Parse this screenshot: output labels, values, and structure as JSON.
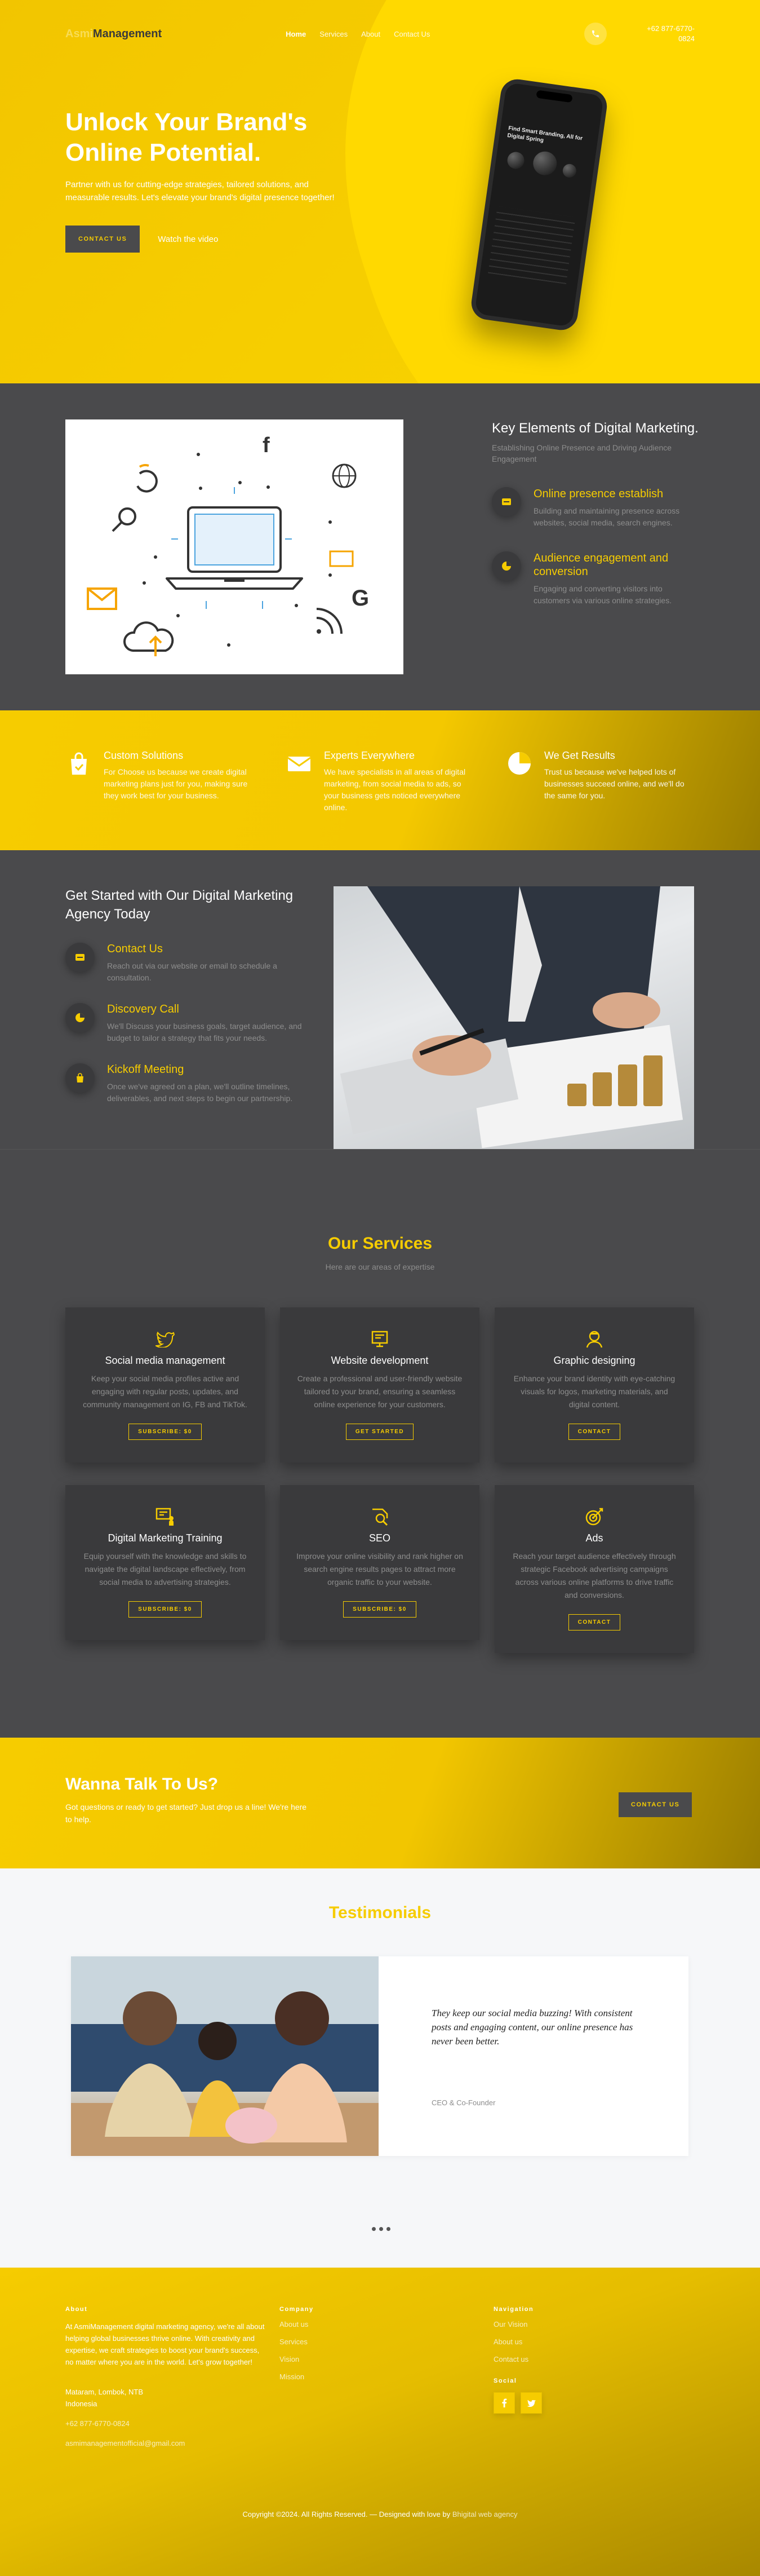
{
  "nav": {
    "logo_prefix": "Asmi",
    "logo_main": "Management",
    "links": [
      "Home",
      "Services",
      "About",
      "Contact Us"
    ],
    "phone": "+62 877-6770-0824"
  },
  "hero": {
    "title": "Unlock Your Brand's Online Potential.",
    "text": "Partner with us for cutting-edge strategies, tailored solutions, and measurable results. Let's elevate your brand's digital presence together!",
    "cta": "Contact Us",
    "watch": "Watch the video",
    "phone_screen_title": "Find Smart Branding, All for Digital Spring"
  },
  "key": {
    "title": "Key Elements of Digital Marketing.",
    "subtitle": "Establishing Online Presence and Driving Audience Engagement",
    "features": [
      {
        "title": "Online presence establish",
        "text": "Building and maintaining presence across websites, social media, search engines."
      },
      {
        "title": "Audience engagement and conversion",
        "text": "Engaging and converting visitors into customers via various online strategies."
      }
    ]
  },
  "strip": [
    {
      "title": "Custom Solutions",
      "text": "For Choose us because we create digital marketing plans just for you, making sure they work best for your business."
    },
    {
      "title": "Experts Everywhere",
      "text": "We have specialists in all areas of digital marketing, from social media to ads, so your business gets noticed everywhere online."
    },
    {
      "title": "We Get Results",
      "text": "Trust us because we've helped lots of businesses succeed online, and we'll do the same for you."
    }
  ],
  "started": {
    "title": "Get Started with Our Digital Marketing Agency Today",
    "steps": [
      {
        "title": "Contact Us",
        "text": "Reach out via our website or email to schedule a consultation."
      },
      {
        "title": "Discovery Call",
        "text": "We'll Discuss your business goals, target audience, and budget to tailor a strategy that fits your needs."
      },
      {
        "title": "Kickoff Meeting",
        "text": "Once we've agreed on a plan, we'll outline timelines, deliverables, and next steps to begin our partnership."
      }
    ]
  },
  "services": {
    "title": "Our Services",
    "subtitle": "Here are our areas of expertise",
    "cards": [
      {
        "title": "Social media management",
        "text": "Keep your social media profiles active and engaging with regular posts, updates, and community management on IG, FB and TikTok.",
        "button": "Subscribe: $0",
        "icon": "twitter-icon"
      },
      {
        "title": "Website development",
        "text": "Create a professional and user-friendly website tailored to your brand, ensuring a seamless online experience for your customers.",
        "button": "Get Started",
        "icon": "monitor-icon"
      },
      {
        "title": "Graphic designing",
        "text": "Enhance your brand identity with eye-catching visuals for logos, marketing materials, and digital content.",
        "button": "Contact",
        "icon": "designer-icon"
      },
      {
        "title": "Digital Marketing Training",
        "text": "Equip yourself with the knowledge and skills to navigate the digital landscape effectively, from social media to advertising strategies.",
        "button": "Subscribe: $0",
        "icon": "training-icon"
      },
      {
        "title": "SEO",
        "text": "Improve your online visibility and rank higher on search engine results pages to attract more organic traffic to your website.",
        "button": "Subscribe: $0",
        "icon": "seo-icon"
      },
      {
        "title": "Ads",
        "text": "Reach your target audience effectively through strategic Facebook advertising campaigns across various online platforms to drive traffic and conversions.",
        "button": "Contact",
        "icon": "target-icon"
      }
    ]
  },
  "cta": {
    "title": "Wanna Talk To Us?",
    "text": "Got questions or ready to get started? Just drop us a line! We're here to help.",
    "button": "Contact Us"
  },
  "testimonials": {
    "title": "Testimonials",
    "quote": "They keep our social media buzzing! With consistent posts and engaging content, our online presence has never been better.",
    "author": "CEO & Co-Founder"
  },
  "footer": {
    "about_heading": "About",
    "about_text": "At AsmiManagement digital marketing agency, we're all about helping global businesses thrive online. With creativity and expertise, we craft strategies to boost your brand's success, no matter where you are in the world. Let's grow together!",
    "address": "Mataram, Lombok, NTB Indonesia",
    "phone": "+62 877-6770-0824",
    "email": "asmimanagementofficial@gmail.com",
    "company_heading": "Company",
    "company_links": [
      "About us",
      "Services",
      "Vision",
      "Mission"
    ],
    "navigation_heading": "Navigation",
    "navigation_links": [
      "Our Vision",
      "About us",
      "Contact us"
    ],
    "social_heading": "Social",
    "copyright": "Copyright ©2024. All Rights Reserved. — Designed with love by",
    "credit": "Bhigital web agency"
  },
  "colors": {
    "accent": "#f6cc00",
    "dark": "#4a4a4c",
    "card": "#3a3a3c",
    "muted": "#8d8d8d"
  }
}
